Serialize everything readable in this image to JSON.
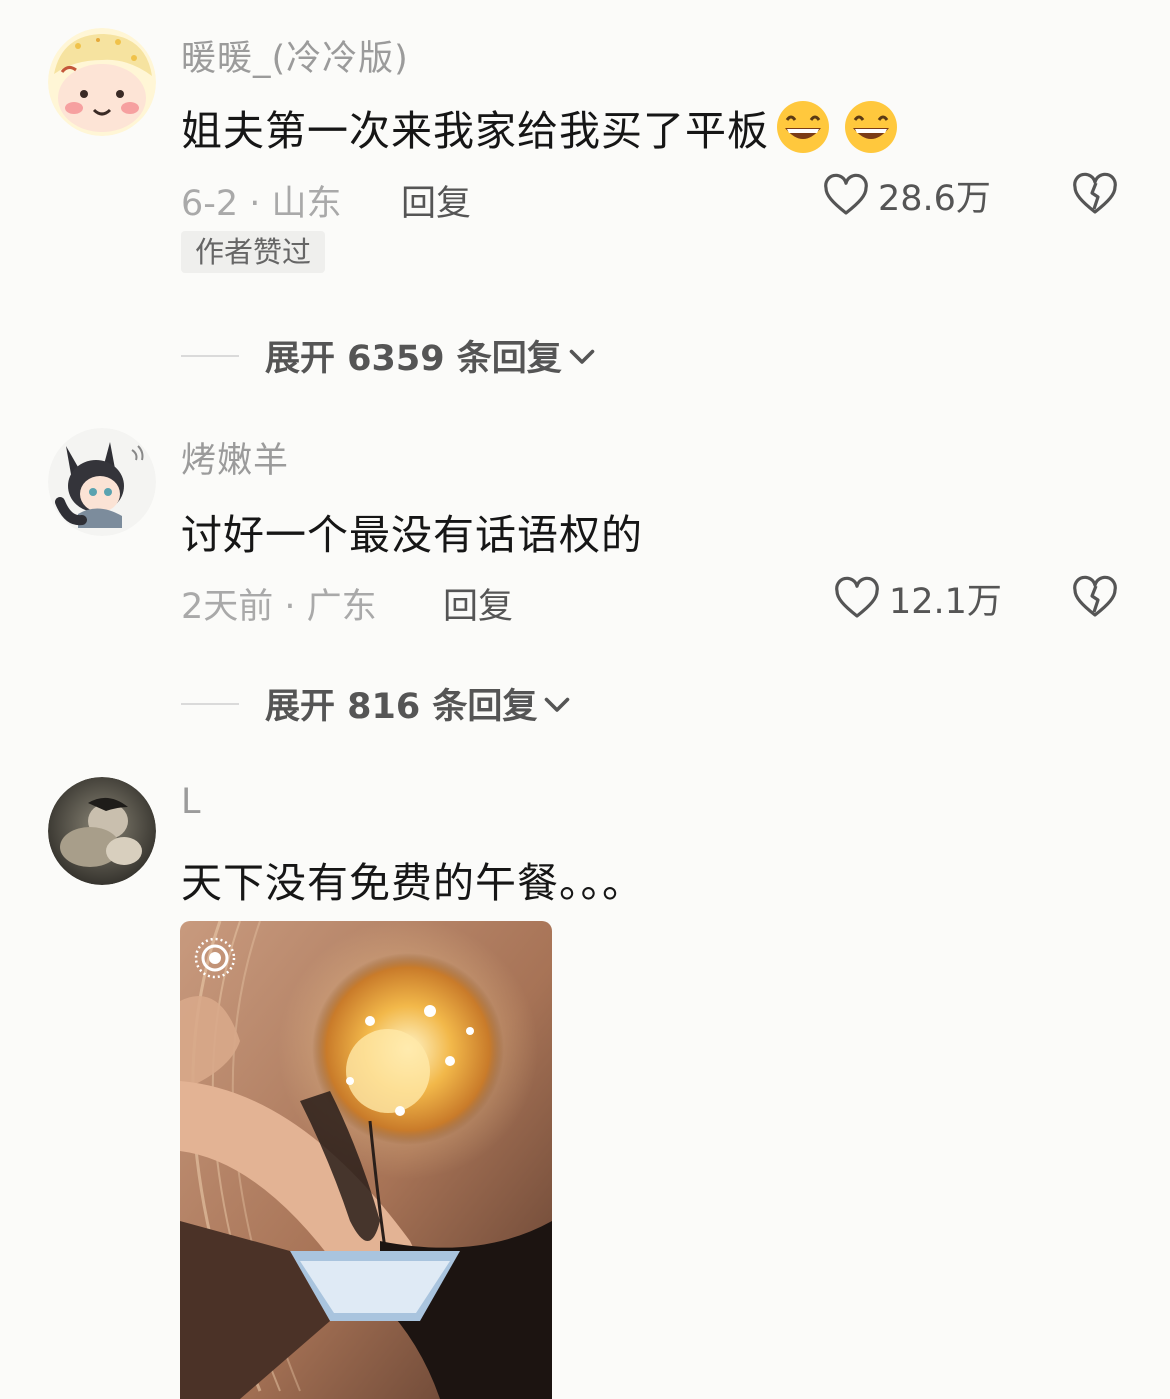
{
  "comments": [
    {
      "username": "暖暖_(冷冷版)",
      "content": "姐夫第一次来我家给我买了平板",
      "emoji_name": "grinning-sweat-emoji",
      "meta": "6-2 · 山东",
      "reply_label": "回复",
      "likes": "28.6万",
      "badge": "作者赞过",
      "expand": "展开 6359 条回复"
    },
    {
      "username": "烤嫩羊",
      "content": "讨好一个最没有话语权的",
      "meta": "2天前 · 广东",
      "reply_label": "回复",
      "likes": "12.1万",
      "expand": "展开 816 条回复"
    },
    {
      "username": "L",
      "content": "天下没有免费的午餐。。。",
      "image_icon": "live-photo-icon"
    }
  ],
  "colors": {
    "background": "#fbfbf9",
    "username": "#9b9b9b",
    "content": "#161616",
    "secondary": "#555555"
  }
}
